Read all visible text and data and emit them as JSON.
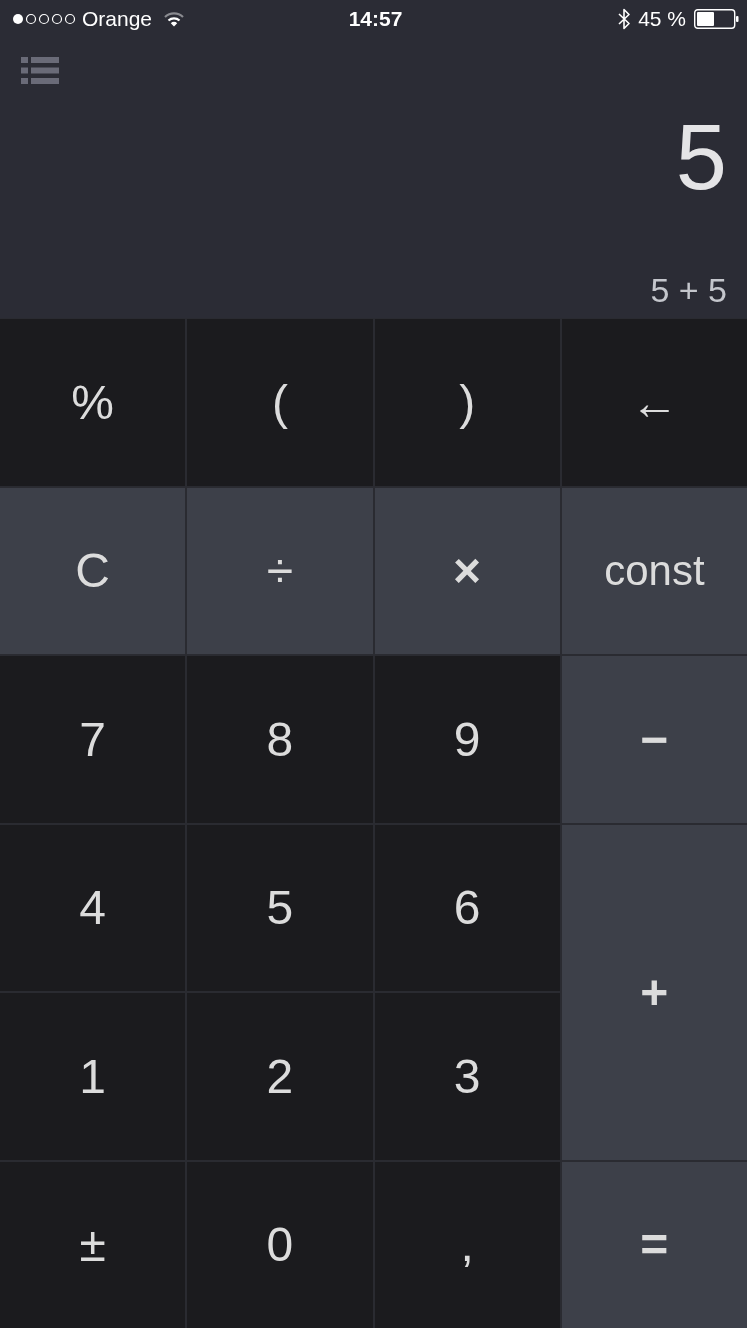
{
  "status_bar": {
    "carrier": "Orange",
    "time": "14:57",
    "battery": "45 %"
  },
  "display": {
    "result": "5",
    "expression": "5 + 5"
  },
  "keys": [
    {
      "label": "%",
      "kind": "basic",
      "tall": false
    },
    {
      "label": "(",
      "kind": "basic",
      "tall": false
    },
    {
      "label": ")",
      "kind": "basic",
      "tall": false
    },
    {
      "label": "←",
      "kind": "basic",
      "tall": false
    },
    {
      "label": "C",
      "kind": "action",
      "tall": false
    },
    {
      "label": "÷",
      "kind": "action",
      "tall": false
    },
    {
      "label": "×",
      "kind": "action",
      "tall": false
    },
    {
      "label": "const",
      "kind": "action",
      "tall": false
    },
    {
      "label": "7",
      "kind": "basic",
      "tall": false
    },
    {
      "label": "8",
      "kind": "basic",
      "tall": false
    },
    {
      "label": "9",
      "kind": "basic",
      "tall": false
    },
    {
      "label": "−",
      "kind": "action",
      "tall": false
    },
    {
      "label": "4",
      "kind": "basic",
      "tall": false
    },
    {
      "label": "5",
      "kind": "basic",
      "tall": false
    },
    {
      "label": "6",
      "kind": "basic",
      "tall": false
    },
    {
      "label": "+",
      "kind": "action",
      "tall": true
    },
    {
      "label": "1",
      "kind": "basic",
      "tall": false
    },
    {
      "label": "2",
      "kind": "basic",
      "tall": false
    },
    {
      "label": "3",
      "kind": "basic",
      "tall": false
    },
    {
      "label": "±",
      "kind": "basic",
      "tall": false
    },
    {
      "label": "0",
      "kind": "basic",
      "tall": false
    },
    {
      "label": ",",
      "kind": "basic",
      "tall": false
    },
    {
      "label": "=",
      "kind": "action",
      "tall": false
    }
  ]
}
